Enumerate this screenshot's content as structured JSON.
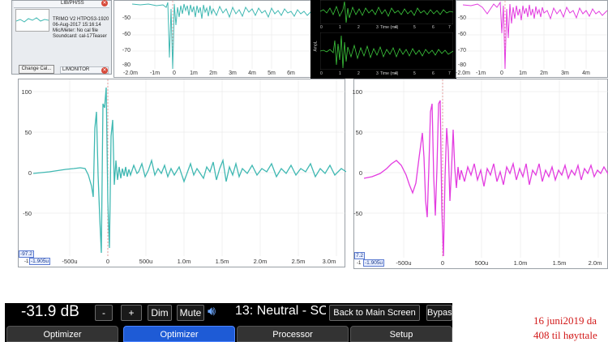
{
  "left_window": {
    "meas_name": "TRIMO V2 HTPOS3-1920",
    "meas_date": "06-Aug-2017 15:16:14",
    "mic_note": "Mic/Meter: No cal file",
    "soundcard": "Soundcard: cal-17Teaser",
    "change_cal_label": "Change Cal...",
    "slot_top_label": "LIB/PH/SS",
    "slot_bottom_label": "L/MONITOR",
    "close_icon": "close-icon"
  },
  "top_left_chart": {
    "y_ticks": [
      "-50",
      "-60",
      "-70",
      "-80"
    ],
    "x_ticks": [
      "-2.0m",
      "-1m",
      "0",
      "1m",
      "2m",
      "3m",
      "4m",
      "5m",
      "6m"
    ]
  },
  "scope": {
    "trace_color": "#3cc83c",
    "top_x_ticks": [
      "0",
      "1",
      "2",
      "3",
      "4",
      "5",
      "6",
      "7"
    ],
    "top_x_label": "Time (ms)",
    "bottom_y_label": "AmpL",
    "bottom_x_ticks": [
      "0",
      "1",
      "2",
      "3",
      "4",
      "5",
      "6",
      "7"
    ],
    "bottom_x_label": "Time (ms)"
  },
  "top_right_chart": {
    "y_ticks": [
      "-50",
      "-60",
      "-70",
      "-80"
    ],
    "x_ticks": [
      "-2.0m",
      "-1m",
      "0",
      "1m",
      "2m",
      "3m",
      "4m"
    ]
  },
  "main_left_chart": {
    "color": "#3fb8b2",
    "y_ticks": [
      "100",
      "50",
      "0",
      "-50"
    ],
    "x_ticks": [
      "-500u",
      "0",
      "500u",
      "1.0m",
      "1.5m",
      "2.0m",
      "2.5m",
      "3.0m"
    ],
    "cursor_y": "-97.2",
    "cursor_x": "-1.905u",
    "edge_label": "-1"
  },
  "main_right_chart": {
    "color": "#e33ce0",
    "y_ticks": [
      "100",
      "50",
      "0",
      "-50"
    ],
    "x_ticks": [
      "-500u",
      "0",
      "500u",
      "1.0m",
      "1.5m",
      "2.0m"
    ],
    "cursor_y": "7.2",
    "cursor_x": "-1.905u",
    "edge_label": "-1"
  },
  "controller": {
    "volume": "-31.9 dB",
    "minus_label": "-",
    "plus_label": "+",
    "dim_label": "Dim",
    "mute_label": "Mute",
    "preset": "13: Neutral - SO",
    "back_label": "Back to Main Screen",
    "bypass_label": "Bypas",
    "tabs": [
      "Optimizer",
      "Optimizer",
      "Processor",
      "Setup"
    ]
  },
  "note": {
    "line1": "16 juni2019 da",
    "line2": "408 til høyttale"
  }
}
